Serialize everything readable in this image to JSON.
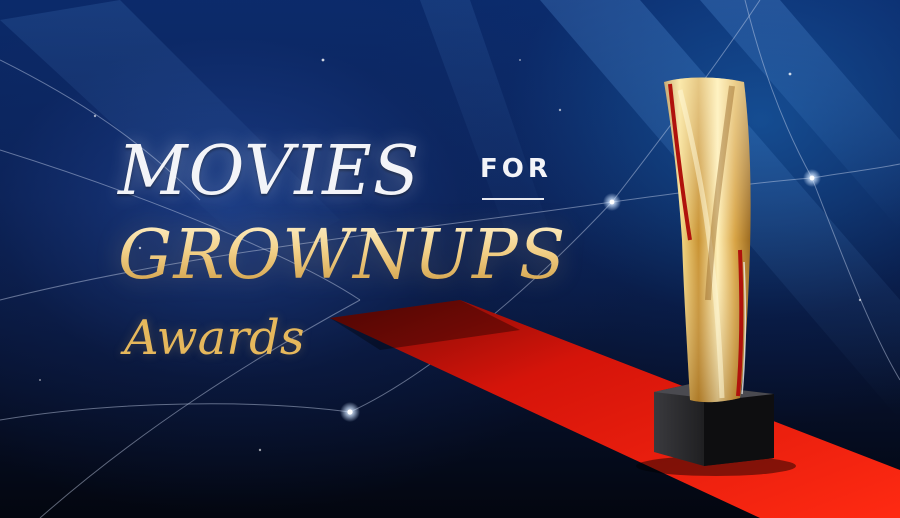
{
  "headline": {
    "line1": "MOVIES",
    "connector": "FOR",
    "line2": "GROWNUPS",
    "line3": "Awards"
  },
  "colors": {
    "background_top": "#0a2a6a",
    "background_bottom": "#03060f",
    "headline_white": "#f3f4f8",
    "headline_gold": "#e6b85c",
    "carpet_red": "#e01508",
    "trophy_gold": "#d9ae48",
    "trophy_base": "#1c1c1e"
  },
  "icons": [
    "trophy-icon",
    "red-carpet",
    "sparkle-star"
  ]
}
